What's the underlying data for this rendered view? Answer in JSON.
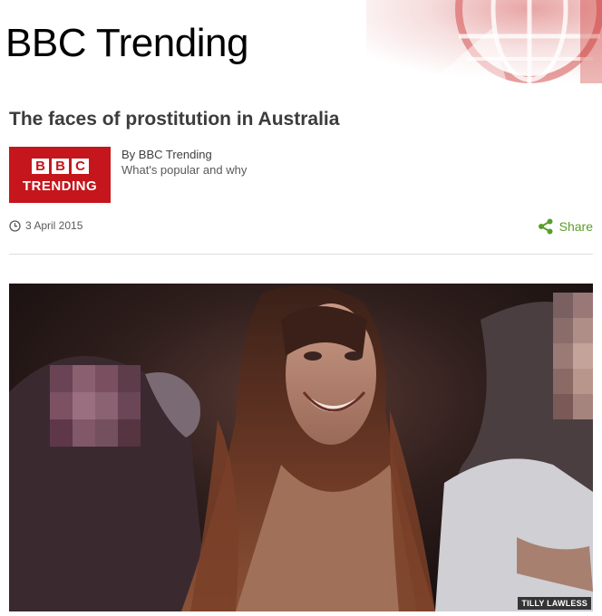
{
  "site": {
    "title": "BBC Trending"
  },
  "article": {
    "headline": "The faces of prostitution in Australia",
    "logo": {
      "letters": [
        "B",
        "B",
        "C"
      ],
      "word": "TRENDING"
    },
    "byline": {
      "author": "By BBC Trending",
      "tagline": "What's popular and why"
    },
    "date": "3 April 2015",
    "share_label": "Share",
    "image": {
      "credit": "TILLY LAWLESS"
    }
  },
  "colors": {
    "brand_red": "#c4161c",
    "share_green": "#5a9e2a"
  }
}
